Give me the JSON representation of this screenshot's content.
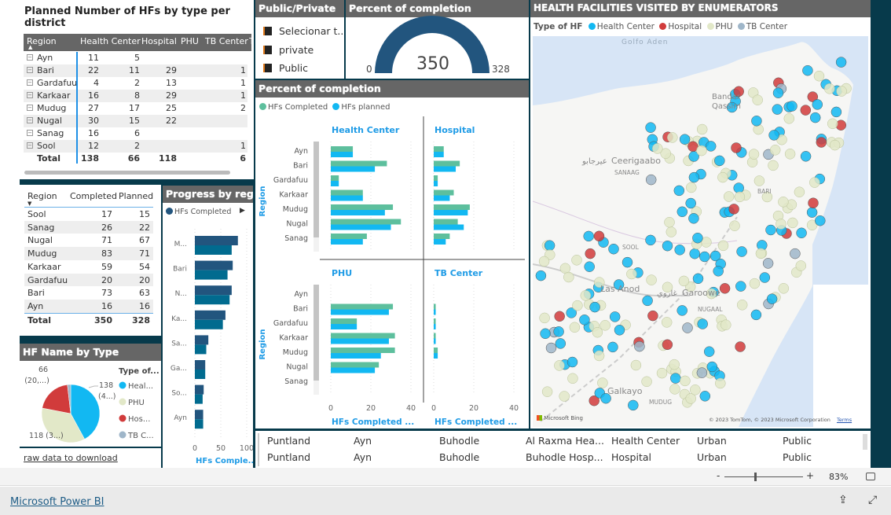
{
  "colors": {
    "completed": "#5dbf9d",
    "planned": "#12b8f2",
    "progress_completed": "#22557e",
    "progress_planned": "#016b8f",
    "health_center": "#12b8f2",
    "hospital": "#d13b3b",
    "phu": "#e2e8c8",
    "tb_center": "#9fb6c9",
    "gauge": "#22557e",
    "canvas": "#073a4b"
  },
  "matrix": {
    "title": "Planned Number of HFs by type per district",
    "columns": [
      "Region",
      "Health Center",
      "Hospital",
      "PHU",
      "TB Center",
      "T"
    ],
    "rows": [
      [
        "Ayn",
        "11",
        "5",
        "",
        ""
      ],
      [
        "Bari",
        "22",
        "11",
        "29",
        "1"
      ],
      [
        "Gardafuu",
        "4",
        "2",
        "13",
        "1"
      ],
      [
        "Karkaar",
        "16",
        "8",
        "29",
        "1"
      ],
      [
        "Mudug",
        "27",
        "17",
        "25",
        "2"
      ],
      [
        "Nugal",
        "30",
        "15",
        "22",
        ""
      ],
      [
        "Sanag",
        "16",
        "6",
        "",
        ""
      ],
      [
        "Sool",
        "12",
        "2",
        "",
        "1"
      ]
    ],
    "total": [
      "Total",
      "138",
      "66",
      "118",
      "6"
    ]
  },
  "region_table": {
    "columns": [
      "Region",
      "Completed",
      "Planned"
    ],
    "rows": [
      [
        "Sool",
        "17",
        "15"
      ],
      [
        "Sanag",
        "26",
        "22"
      ],
      [
        "Nugal",
        "71",
        "67"
      ],
      [
        "Mudug",
        "83",
        "71"
      ],
      [
        "Karkaar",
        "59",
        "54"
      ],
      [
        "Gardafuu",
        "20",
        "20"
      ],
      [
        "Bari",
        "73",
        "63"
      ],
      [
        "Ayn",
        "16",
        "16"
      ]
    ],
    "total": [
      "Total",
      "350",
      "328"
    ]
  },
  "pie": {
    "title": "HF Name by Type",
    "legend_title": "Type of...",
    "legend": [
      "Heal...",
      "PHU",
      "Hos...",
      "TB C..."
    ],
    "labels": {
      "hc": "138",
      "hc_pct": "(4...)",
      "hosp": "66",
      "hosp_pct": "(20,...)",
      "phu": "118 (3...)"
    }
  },
  "link": "raw data to download",
  "slicer": {
    "title": "Public/Private",
    "items": [
      "Selecionar t...",
      "private",
      "Public"
    ]
  },
  "gauge": {
    "title": "Percent of completion",
    "min": "0",
    "value": "350",
    "max": "328"
  },
  "chart_data": [
    {
      "type": "bar",
      "title": "Percent of completion",
      "legend": [
        "HFs Completed",
        "HFs planned"
      ],
      "ylabel": "Region",
      "xlabel": "HFs Completed ...",
      "xlim": [
        0,
        40
      ],
      "xticks": [
        "0",
        "20",
        "40"
      ],
      "categories": [
        "Ayn",
        "Bari",
        "Gardafuu",
        "Karkaar",
        "Mudug",
        "Nugal",
        "Sanag"
      ],
      "panels": [
        {
          "name": "Health Center",
          "completed": [
            11,
            28,
            4,
            16,
            31,
            35,
            18
          ],
          "planned": [
            11,
            22,
            4,
            16,
            27,
            30,
            16
          ]
        },
        {
          "name": "Hospital",
          "completed": [
            5,
            13,
            2,
            10,
            18,
            12,
            8
          ],
          "planned": [
            5,
            11,
            2,
            8,
            17,
            15,
            6
          ]
        },
        {
          "name": "PHU",
          "completed": [
            0,
            31,
            13,
            32,
            32,
            24,
            0
          ],
          "planned": [
            0,
            29,
            13,
            29,
            25,
            22,
            0
          ]
        },
        {
          "name": "TB Center",
          "completed": [
            0,
            1,
            1,
            1,
            2,
            0,
            0
          ],
          "planned": [
            0,
            1,
            1,
            1,
            2,
            0,
            0
          ]
        }
      ]
    },
    {
      "type": "bar",
      "title": "Progress by region",
      "legend": [
        "HFs Completed"
      ],
      "xlabel": "HFs Comple...",
      "xlim": [
        0,
        100
      ],
      "xticks": [
        "0",
        "50",
        "100"
      ],
      "categories": [
        "M...",
        "Bari",
        "N...",
        "Ka...",
        "Sa...",
        "Ga...",
        "So...",
        "Ayn"
      ],
      "series": [
        {
          "name": "HFs Completed",
          "values": [
            83,
            73,
            71,
            59,
            26,
            20,
            17,
            16
          ]
        },
        {
          "values": [
            71,
            63,
            67,
            54,
            22,
            20,
            15,
            16
          ]
        }
      ]
    },
    {
      "type": "pie",
      "categories": [
        "Health Center",
        "PHU",
        "Hospital",
        "TB Center"
      ],
      "values": [
        138,
        118,
        66,
        6
      ]
    }
  ],
  "map": {
    "title": "HEALTH FACILITIES VISITED BY ENUMERATORS",
    "legend_title": "Type of HF",
    "legend": [
      "Health Center",
      "Hospital",
      "PHU",
      "TB Center"
    ],
    "places": {
      "gulf": "Golfo Aden",
      "bandar": "Bandar",
      "qassim": "Qassim",
      "ceeri": "Ceerigaabo",
      "ceeri_ar": "عيرجابو",
      "sanaag": "SANAAG",
      "bari": "BARI",
      "sool": "SOOL",
      "lasanod": "Las Anod",
      "garoowe": "Garoowe",
      "garoowe_ar": "غاروي",
      "nugaal": "NUGAAL",
      "galkayo": "Galkayo",
      "mudug": "MUDUG"
    },
    "bing": "Microsoft Bing",
    "copyright": "© 2023 TomTom, © 2023 Microsoft Corporation",
    "terms": "Terms"
  },
  "detail_table": {
    "rows": [
      [
        "Puntland",
        "Ayn",
        "Buhodle",
        "Al Raxma Hea...",
        "Health Center",
        "Urban",
        "Public"
      ],
      [
        "Puntland",
        "Ayn",
        "Buhodle",
        "Buhodle Hosp...",
        "Hospital",
        "Urban",
        "Public"
      ]
    ]
  },
  "zoom": {
    "minus": "-",
    "plus": "+",
    "level": "83%",
    "level_value": 83
  },
  "footer": {
    "brand": "Microsoft Power BI"
  }
}
